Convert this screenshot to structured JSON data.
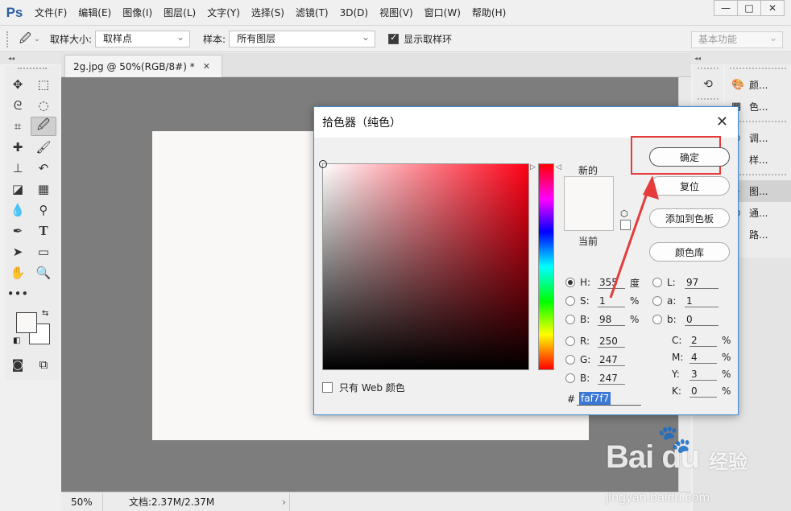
{
  "app": {
    "logo": "Ps",
    "menu": [
      "文件(F)",
      "编辑(E)",
      "图像(I)",
      "图层(L)",
      "文字(Y)",
      "选择(S)",
      "滤镜(T)",
      "3D(D)",
      "视图(V)",
      "窗口(W)",
      "帮助(H)"
    ],
    "window_controls": {
      "minimize": "—",
      "maximize": "□",
      "close": "✕"
    }
  },
  "options_bar": {
    "sample_size_label": "取样大小:",
    "sample_size_value": "取样点",
    "sample_label": "样本:",
    "sample_value": "所有图层",
    "show_ring_label": "显示取样环",
    "show_ring_checked": true,
    "workspace": "基本功能"
  },
  "document": {
    "tab_title": "2g.jpg @ 50%(RGB/8#) *",
    "tab_close": "✕",
    "canvas_color": "#faf7f7",
    "zoom": "50%",
    "doc_info": "文档:2.37M/2.37M"
  },
  "right_panels": {
    "items": [
      {
        "label": "颜...",
        "icon": "palette-icon"
      },
      {
        "label": "色...",
        "icon": "swatches-icon"
      },
      {
        "label": "调...",
        "icon": "adjustments-icon"
      },
      {
        "label": "样...",
        "icon": "styles-icon"
      },
      {
        "label": "图...",
        "icon": "layers-icon"
      },
      {
        "label": "通...",
        "icon": "channels-icon"
      },
      {
        "label": "路...",
        "icon": "paths-icon"
      }
    ]
  },
  "color_picker": {
    "title": "拾色器（纯色）",
    "new_label": "新的",
    "current_label": "当前",
    "web_only_label": "只有 Web 颜色",
    "buttons": {
      "ok": "确定",
      "reset": "复位",
      "add_to_swatches": "添加到色板",
      "color_libraries": "颜色库"
    },
    "hsb": {
      "h_label": "H:",
      "h_value": "355",
      "h_unit": "度",
      "s_label": "S:",
      "s_value": "1",
      "s_unit": "%",
      "b_label": "B:",
      "b_value": "98",
      "b_unit": "%"
    },
    "rgb": {
      "r_label": "R:",
      "r_value": "250",
      "g_label": "G:",
      "g_value": "247",
      "b_label": "B:",
      "b_value": "247"
    },
    "lab": {
      "l_label": "L:",
      "l_value": "97",
      "a_label": "a:",
      "a_value": "1",
      "b_label": "b:",
      "b_value": "0"
    },
    "cmyk": {
      "c_label": "C:",
      "c_value": "2",
      "m_label": "M:",
      "m_value": "4",
      "y_label": "Y:",
      "y_value": "3",
      "k_label": "K:",
      "k_value": "0",
      "unit": "%"
    },
    "hex_label": "#",
    "hex_value": "faf7f7",
    "current_color": "#faf7f7",
    "accent_color": "#ff0015"
  },
  "watermark": {
    "logo": "Bai du",
    "text": "经验",
    "url": "jingyan.baidu.com"
  }
}
